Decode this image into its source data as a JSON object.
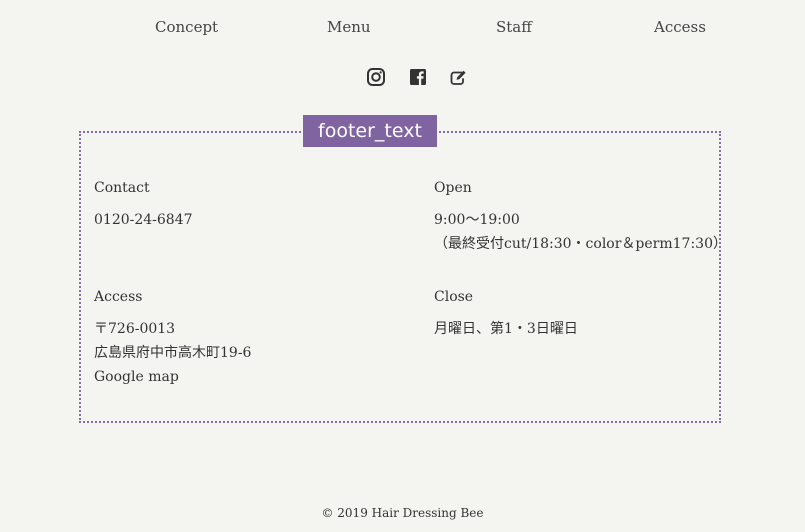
{
  "nav": {
    "items": [
      "Concept",
      "Menu",
      "Staff",
      "Access"
    ]
  },
  "social": {
    "icons": [
      "instagram-icon",
      "facebook-icon",
      "blog-edit-icon"
    ]
  },
  "annotation": {
    "label": "footer_text",
    "color": "#8064a2"
  },
  "footer": {
    "contact": {
      "heading": "Contact",
      "phone": "0120-24-6847"
    },
    "open": {
      "heading": "Open",
      "hours": "9:00～19:00",
      "note": "（最終受付cut/18:30・color＆perm17:30）"
    },
    "access": {
      "heading": "Access",
      "postal": "〒726-0013",
      "address": "広島県府中市高木町19-6",
      "map_link": "Google map"
    },
    "close": {
      "heading": "Close",
      "days": "月曜日、第1・3日曜日"
    }
  },
  "copyright": "© 2019 Hair Dressing Bee"
}
